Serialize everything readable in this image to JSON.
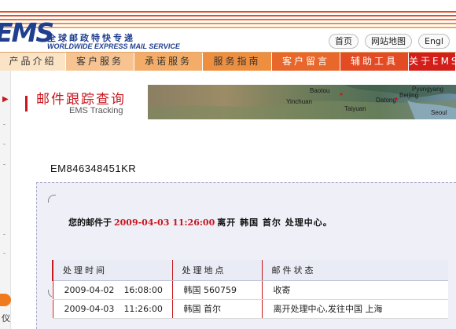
{
  "header": {
    "logo_text": "EMS",
    "logo_cn": "全球邮政特快专递",
    "logo_en": "WORLDWIDE EXPRESS MAIL SERVICE",
    "top_links": [
      "首页",
      "网站地图",
      "Engl"
    ]
  },
  "nav": {
    "items": [
      {
        "label": "产品介绍",
        "bg": "#fbe3c6",
        "color": "#333333"
      },
      {
        "label": "客户服务",
        "bg": "#f6c391",
        "color": "#333333"
      },
      {
        "label": "承诺服务",
        "bg": "#f3ad69",
        "color": "#333333"
      },
      {
        "label": "服务指南",
        "bg": "#ee8f3f",
        "color": "#333333"
      },
      {
        "label": "客户留言",
        "bg": "#e8672a",
        "color": "#ffffff"
      },
      {
        "label": "辅助工具",
        "bg": "#e24b24",
        "color": "#ffffff"
      },
      {
        "label": "关于EMS",
        "bg": "#d21f19",
        "color": "#ffffff"
      }
    ]
  },
  "left": {
    "arrow": "▶",
    "bottom_text": "仪"
  },
  "banner": {
    "title_cn": "邮件跟踪查询",
    "title_en": "EMS Tracking",
    "map_labels": [
      "Baotou",
      "Beijing",
      "Pyongyang",
      "Yinchuan",
      "Taiyuan",
      "Datong",
      "Seoul"
    ]
  },
  "tracking": {
    "number": "EM846348451KR"
  },
  "status": {
    "prefix": "您的邮件于",
    "datetime": "2009-04-03 11:26:00",
    "suffix": "离开  韩国  首尔  处理中心。"
  },
  "table": {
    "headers": [
      "处理时间",
      "处理地点",
      "邮件状态"
    ],
    "rows": [
      {
        "date": "2009-04-02",
        "time": "16:08:00",
        "place": "韩国 560759",
        "status": "收寄"
      },
      {
        "date": "2009-04-03",
        "time": "11:26:00",
        "place": "韩国 首尔",
        "status": "离开处理中心,发往中国 上海"
      }
    ]
  },
  "colors": {
    "brand_blue": "#1f3f8f",
    "accent_red": "#c8161d",
    "nav_orange": "#ee8f3f",
    "panel_bg": "#eeeff7"
  }
}
